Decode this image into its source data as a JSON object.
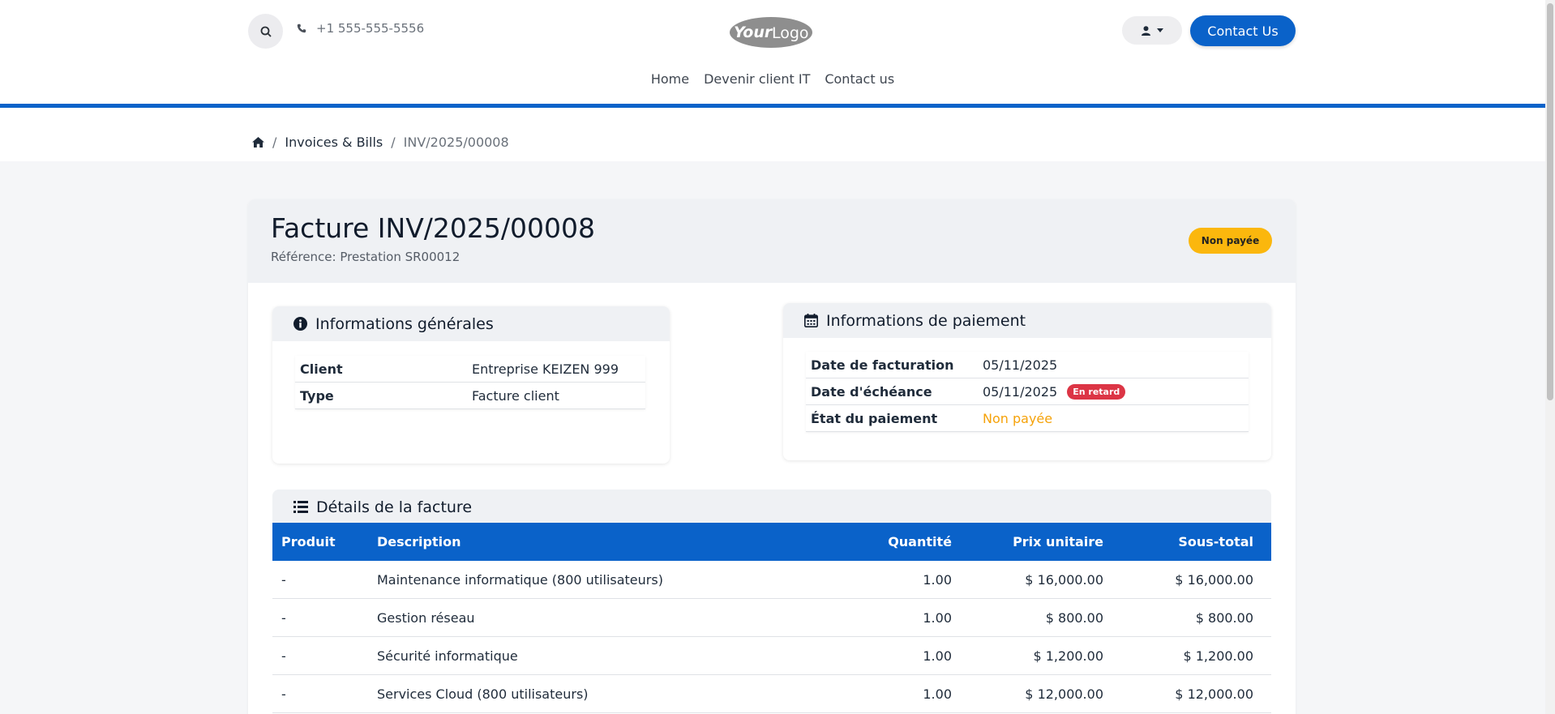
{
  "header": {
    "phone": "+1 555-555-5556",
    "logo_text_bold": "Your",
    "logo_text_light": "Logo",
    "contact_button": "Contact Us",
    "nav": [
      "Home",
      "Devenir client IT",
      "Contact us"
    ]
  },
  "breadcrumb": {
    "invoices": "Invoices & Bills",
    "current": "INV/2025/00008",
    "separator": "/"
  },
  "invoice": {
    "title": "Facture INV/2025/00008",
    "reference": "Référence: Prestation SR00012",
    "status_badge": "Non payée"
  },
  "general_info": {
    "heading": "Informations générales",
    "rows": [
      {
        "label": "Client",
        "value": "Entreprise KEIZEN 999"
      },
      {
        "label": "Type",
        "value": "Facture client"
      }
    ]
  },
  "payment_info": {
    "heading": "Informations de paiement",
    "invoice_date_label": "Date de facturation",
    "invoice_date": "05/11/2025",
    "due_date_label": "Date d'échéance",
    "due_date": "05/11/2025",
    "late_badge": "En retard",
    "payment_status_label": "État du paiement",
    "payment_status": "Non payée"
  },
  "details": {
    "heading": "Détails de la facture",
    "columns": [
      "Produit",
      "Description",
      "Quantité",
      "Prix unitaire",
      "Sous-total"
    ],
    "rows": [
      {
        "product": "-",
        "description": "Maintenance informatique (800 utilisateurs)",
        "qty": "1.00",
        "price": "$ 16,000.00",
        "subtotal": "$ 16,000.00"
      },
      {
        "product": "-",
        "description": "Gestion réseau",
        "qty": "1.00",
        "price": "$ 800.00",
        "subtotal": "$ 800.00"
      },
      {
        "product": "-",
        "description": "Sécurité informatique",
        "qty": "1.00",
        "price": "$ 1,200.00",
        "subtotal": "$ 1,200.00"
      },
      {
        "product": "-",
        "description": "Services Cloud (800 utilisateurs)",
        "qty": "1.00",
        "price": "$ 12,000.00",
        "subtotal": "$ 12,000.00"
      }
    ]
  },
  "colors": {
    "brand_blue": "#0a62c9",
    "warning_yellow": "#fbb70d",
    "danger_red": "#dc3545"
  }
}
